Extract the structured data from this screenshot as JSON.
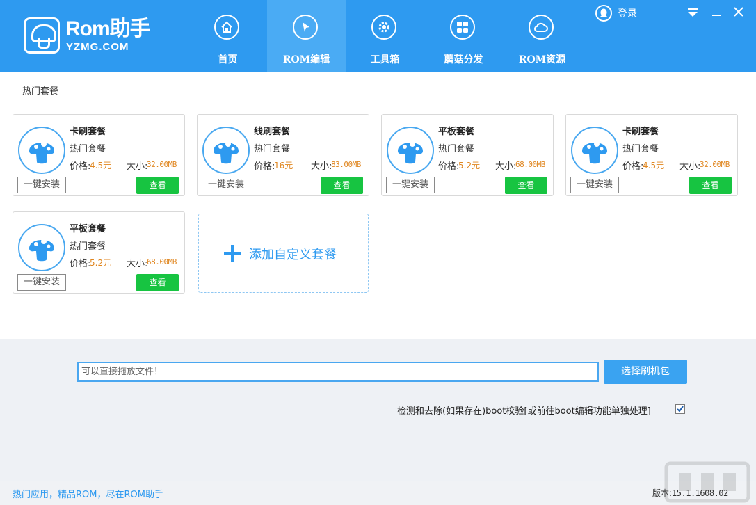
{
  "app": {
    "logo_text": "Rom助手",
    "logo_sub": "YZMG.COM"
  },
  "nav": [
    {
      "label": "首页",
      "icon": "home-icon"
    },
    {
      "label": "ROM编辑",
      "icon": "cursor-icon"
    },
    {
      "label": "工具箱",
      "icon": "gear-icon"
    },
    {
      "label": "蘑菇分发",
      "icon": "grid-icon"
    },
    {
      "label": "ROM资源",
      "icon": "cloud-icon"
    }
  ],
  "active_nav": "ROM编辑",
  "login_label": "登录",
  "section_title": "热门套餐",
  "packages": [
    {
      "name": "卡刷套餐",
      "tag": "热门套餐",
      "price_label": "价格:",
      "price": "4.5元",
      "size_label": "大小:",
      "size": "32.00MB",
      "install_label": "一键安装",
      "view_label": "查看"
    },
    {
      "name": "线刷套餐",
      "tag": "热门套餐",
      "price_label": "价格:",
      "price": "16元",
      "size_label": "大小:",
      "size": "83.00MB",
      "install_label": "一键安装",
      "view_label": "查看"
    },
    {
      "name": "平板套餐",
      "tag": "热门套餐",
      "price_label": "价格:",
      "price": "5.2元",
      "size_label": "大小:",
      "size": "68.00MB",
      "install_label": "一键安装",
      "view_label": "查看"
    },
    {
      "name": "卡刷套餐",
      "tag": "热门套餐",
      "price_label": "价格:",
      "price": "4.5元",
      "size_label": "大小:",
      "size": "32.00MB",
      "install_label": "一键安装",
      "view_label": "查看"
    },
    {
      "name": "平板套餐",
      "tag": "热门套餐",
      "price_label": "价格:",
      "price": "5.2元",
      "size_label": "大小:",
      "size": "68.00MB",
      "install_label": "一键安装",
      "view_label": "查看"
    }
  ],
  "add_custom_label": "添加自定义套餐",
  "drop_input_placeholder": "可以直接拖放文件！",
  "choose_button_label": "选择刷机包",
  "boot_option_label": "检测和去除(如果存在)boot校验[或前往boot编辑功能单独处理]",
  "boot_option_checked": true,
  "footer": {
    "slogan": "热门应用，精品ROM，尽在ROM助手",
    "version_label": "版本:",
    "version": "15.1.1608.02"
  },
  "colors": {
    "header": "#2e9af0",
    "active_tab": "#4aabf4",
    "view_button": "#17c441",
    "price": "#e0861f"
  }
}
